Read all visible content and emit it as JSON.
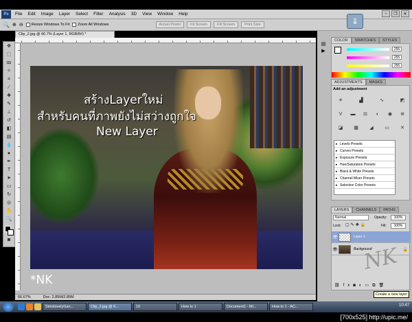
{
  "menu": [
    "File",
    "Edit",
    "Image",
    "Layer",
    "Select",
    "Filter",
    "Analysis",
    "3D",
    "View",
    "Window",
    "Help"
  ],
  "app_logo": "Ps",
  "options": {
    "resize_windows": "Resize Windows To Fit",
    "zoom_all": "Zoom All Windows",
    "buttons": [
      "Actual Pixels",
      "Fit Screen",
      "Fill Screen",
      "Print Size"
    ]
  },
  "document": {
    "tab_title": "Clip_2.jpg @ 66.7% (Layer 1, RGB/8#) *",
    "zoom": "66.67%",
    "doc_size": "Doc: 2.85M/2.85M"
  },
  "canvas_text": {
    "line1": "สร้างLayerใหม่",
    "line2": "สำหรับคนที่ภาพยังไม่สว่างถูกใจ",
    "line3": "New Layer",
    "signature": "*NK"
  },
  "color_panel": {
    "tabs": [
      "COLOR",
      "SWATCHES",
      "STYLES"
    ],
    "r": "255",
    "g": "255",
    "b": "255"
  },
  "adjustments": {
    "tabs": [
      "ADJUSTMENTS",
      "MASKS"
    ],
    "heading": "Add an adjustment",
    "presets": [
      "Levels Presets",
      "Curves Presets",
      "Exposure Presets",
      "Hue/Saturation Presets",
      "Black & White Presets",
      "Channel Mixer Presets",
      "Selective Color Presets"
    ]
  },
  "layers": {
    "tabs": [
      "LAYERS",
      "CHANNELS",
      "PATHS"
    ],
    "blend_mode": "Normal",
    "opacity_label": "Opacity:",
    "opacity": "100%",
    "lock_label": "Lock:",
    "fill_label": "Fill:",
    "fill": "100%",
    "items": [
      "Layer 1",
      "Background"
    ],
    "tooltip": "Create a new layer"
  },
  "taskbar": {
    "tasks": [
      "SimslovelyGan...",
      "Clip_2.jpg @ 6...",
      "10",
      "How to 1",
      "Document1 - Mi...",
      "How to 1 - AC..."
    ],
    "clock": "10:47"
  },
  "credit": "[700x525] http://upic.me/"
}
